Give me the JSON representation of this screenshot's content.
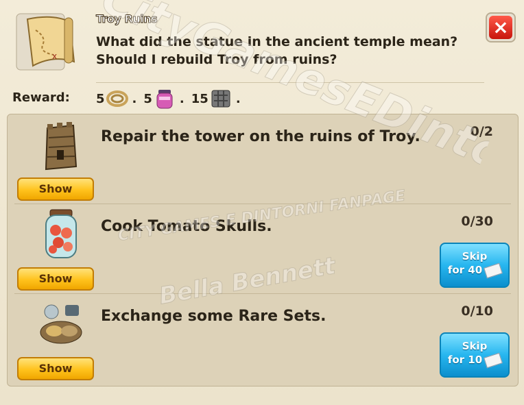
{
  "quest": {
    "title": "Troy Ruins",
    "description": "What did the statue in the ancient temple mean? Should I rebuild Troy from ruins?",
    "close_label": "×"
  },
  "reward": {
    "label": "Reward:",
    "items": [
      {
        "amount": "5",
        "icon": "rope-icon"
      },
      {
        "amount": "5",
        "icon": "jar-icon"
      },
      {
        "amount": "15",
        "icon": "stone-block-icon"
      }
    ]
  },
  "tasks": [
    {
      "text": "Repair the tower on the ruins of Troy.",
      "progress": "0/2",
      "icon": "tower-icon",
      "show_label": "Show",
      "skip": null
    },
    {
      "text": "Cook Tomato Skulls.",
      "progress": "0/30",
      "icon": "tomato-jar-icon",
      "show_label": "Show",
      "skip": {
        "line1": "Skip",
        "line2": "for 40"
      }
    },
    {
      "text": "Exchange some Rare Sets.",
      "progress": "0/10",
      "icon": "rare-set-icon",
      "show_label": "Show",
      "skip": {
        "line1": "Skip",
        "line2": "for 10"
      }
    }
  ],
  "watermarks": {
    "line1": "CityGamesEDintorni",
    "line2": "CITY GAMES E DINTORNI FANPAGE",
    "line3": "Bella Bennett"
  },
  "colors": {
    "panel_bg": "#ece3cc",
    "show_button": "#ffc21c",
    "skip_button": "#27b6ef",
    "close_button": "#e0251a"
  }
}
